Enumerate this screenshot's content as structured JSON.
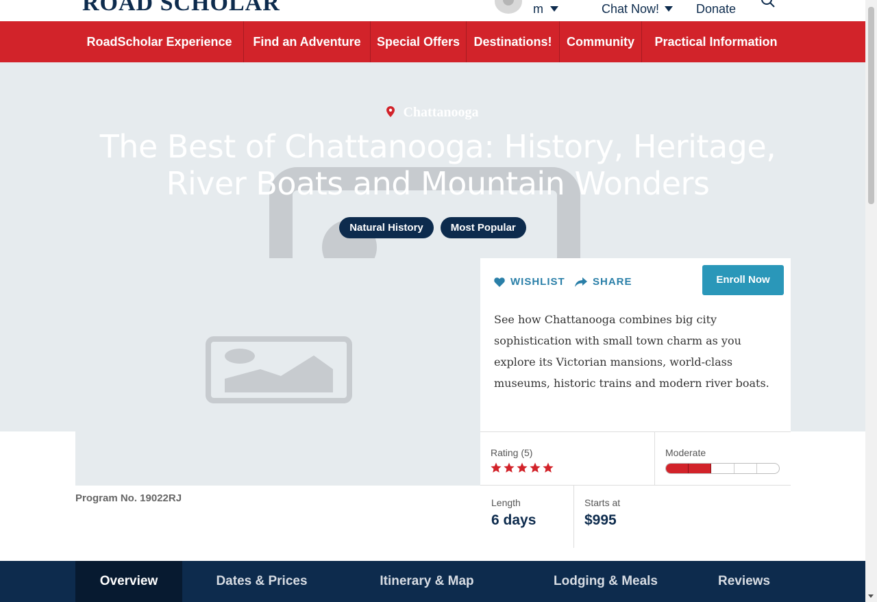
{
  "header": {
    "logo": "ROAD SCHOLAR",
    "user_initial": "m",
    "chat_label": "Chat Now!",
    "donate_label": "Donate"
  },
  "nav": {
    "items": [
      {
        "label": "RoadScholar Experience"
      },
      {
        "label": "Find an Adventure"
      },
      {
        "label": "Special Offers"
      },
      {
        "label": "Destinations!"
      },
      {
        "label": "Community"
      },
      {
        "label": "Practical Information"
      }
    ]
  },
  "hero": {
    "location": "Chattanooga",
    "title": "The Best of Chattanooga: History, Heritage, River Boats and Mountain Wonders",
    "tags": [
      "Natural History",
      "Most Popular"
    ]
  },
  "program": {
    "number_label": "Program No. 19022RJ"
  },
  "panel": {
    "wishlist_label": "WISHLIST",
    "share_label": "SHARE",
    "enroll_label": "Enroll Now",
    "description": "See how Chattanooga combines big city sophistication with small town charm as you explore its Victorian mansions, world-class museums, historic trains and modern river boats."
  },
  "stats": {
    "rating_label": "Rating (5)",
    "rating_stars": 5,
    "activity_label": "Moderate",
    "activity_level": 2,
    "activity_max": 5,
    "length_label": "Length",
    "length_value": "6 days",
    "price_label": "Starts at",
    "price_value": "$995"
  },
  "tabs": {
    "items": [
      {
        "label": "Overview",
        "active": true
      },
      {
        "label": "Dates & Prices",
        "active": false
      },
      {
        "label": "Itinerary & Map",
        "active": false
      },
      {
        "label": "Lodging & Meals",
        "active": false
      },
      {
        "label": "Reviews",
        "active": false
      }
    ]
  },
  "colors": {
    "brand_red": "#d2232a",
    "navy": "#0d2b4d",
    "link_blue": "#2a7fa8",
    "enroll_blue": "#2a97b9"
  }
}
